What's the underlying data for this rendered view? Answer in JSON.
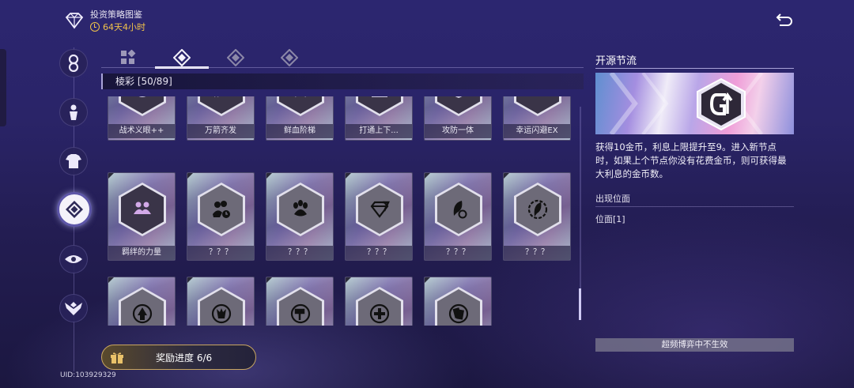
{
  "header": {
    "title": "投资策略图鉴",
    "timer": "64天4小时"
  },
  "tabs": [
    {
      "icon": "grid-icon",
      "active": false
    },
    {
      "icon": "diamond-rank-icon",
      "active": true
    },
    {
      "icon": "diamond-rank-icon",
      "active": false
    },
    {
      "icon": "diamond-rank-icon",
      "active": false
    }
  ],
  "category": "棱彩 [50/89]",
  "cards_row1": [
    "战术义眼++",
    "万箭齐发",
    "鲜血阶梯",
    "打通上下...",
    "攻防一体",
    "幸运闪避EX"
  ],
  "cards_row2": [
    "羁绊的力量",
    "？？？",
    "？？？",
    "？？？",
    "？？？",
    "？？？"
  ],
  "cards_row3_count": 5,
  "reward": {
    "label": "奖励进度 6/6"
  },
  "uid": "UID:103929329",
  "detail": {
    "title": "开源节流",
    "description": "获得10金币，利息上限提升至9。进入新节点时，如果上个节点你没有花费金币，则可获得最大利息的金币数。",
    "location_label": "出现位面",
    "location_value": "位面[1]",
    "status": "超频博弈中不生效"
  },
  "colors": {
    "accent_gold": "#f0c24a",
    "panel_accent": "#a9a3d8"
  }
}
